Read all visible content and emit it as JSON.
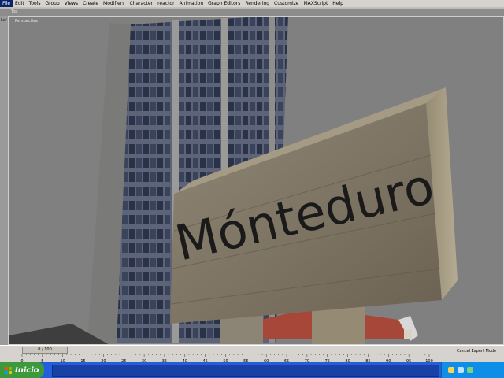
{
  "menu": [
    "File",
    "Edit",
    "Tools",
    "Group",
    "Views",
    "Create",
    "Modifiers",
    "Character",
    "reactor",
    "Animation",
    "Graph Editors",
    "Rendering",
    "Customize",
    "MAXScript",
    "Help"
  ],
  "top_viewport_label": "Top",
  "left_strip_label": "Lef",
  "viewport_label": "Perspective",
  "scene": {
    "sign_text": "Mónteduro"
  },
  "timeline": {
    "frame_counter": "0 / 100",
    "ticks": [
      "0",
      "5",
      "10",
      "15",
      "20",
      "25",
      "30",
      "35",
      "40",
      "45",
      "50",
      "55",
      "60",
      "65",
      "70",
      "75",
      "80",
      "85",
      "90",
      "95",
      "100"
    ]
  },
  "status": {
    "cancel_label": "Cancel Expert Mode"
  },
  "taskbar": {
    "start_label": "Inicio"
  },
  "colors": {
    "taskbar": "#245edb",
    "start": "#3c9a3c",
    "ui_gray": "#d6d3ce"
  }
}
